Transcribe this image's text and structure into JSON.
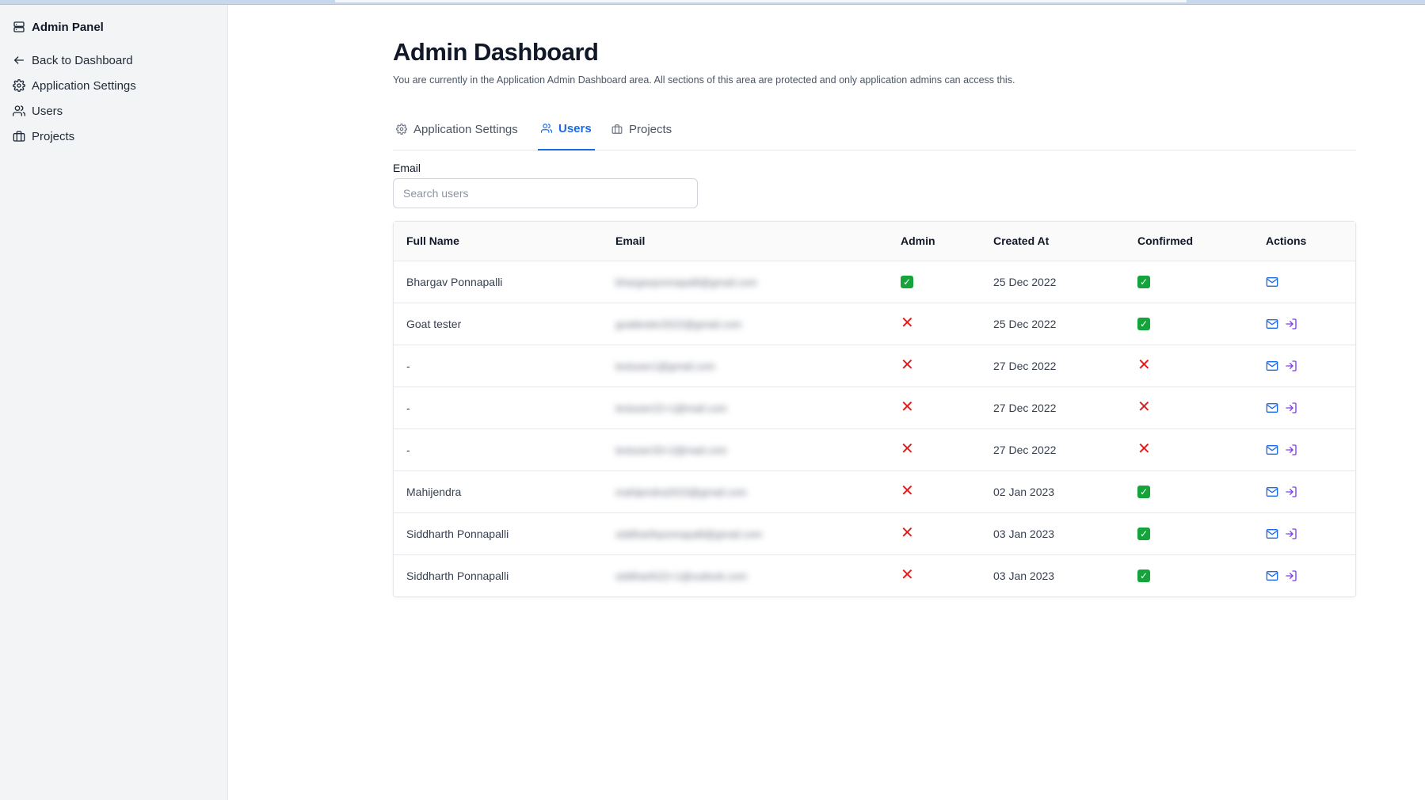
{
  "sidebar": {
    "title": "Admin Panel",
    "items": [
      {
        "label": "Back to Dashboard",
        "icon": "arrow-left-icon"
      },
      {
        "label": "Application Settings",
        "icon": "gear-icon"
      },
      {
        "label": "Users",
        "icon": "users-icon"
      },
      {
        "label": "Projects",
        "icon": "briefcase-icon"
      }
    ]
  },
  "main": {
    "title": "Admin Dashboard",
    "subtitle": "You are currently in the Application Admin Dashboard area. All sections of this area are protected and only application admins can access this.",
    "tabs": [
      {
        "label": "Application Settings",
        "active": false
      },
      {
        "label": "Users",
        "active": true
      },
      {
        "label": "Projects",
        "active": false
      }
    ],
    "search": {
      "label": "Email",
      "placeholder": "Search users",
      "value": ""
    },
    "table": {
      "columns": [
        "Full Name",
        "Email",
        "Admin",
        "Created At",
        "Confirmed",
        "Actions"
      ],
      "rows": [
        {
          "name": "Bhargav Ponnapalli",
          "email": "bhargavponnapalli@gmail.com",
          "admin": true,
          "created": "25 Dec 2022",
          "confirmed": true,
          "impersonate": false
        },
        {
          "name": "Goat tester",
          "email": "goattester2022@gmail.com",
          "admin": false,
          "created": "25 Dec 2022",
          "confirmed": true,
          "impersonate": true
        },
        {
          "name": "-",
          "email": "testuser1@gmail.com",
          "admin": false,
          "created": "27 Dec 2022",
          "confirmed": false,
          "impersonate": true
        },
        {
          "name": "-",
          "email": "testuser22+1@mail.com",
          "admin": false,
          "created": "27 Dec 2022",
          "confirmed": false,
          "impersonate": true
        },
        {
          "name": "-",
          "email": "testuser33+2@mail.com",
          "admin": false,
          "created": "27 Dec 2022",
          "confirmed": false,
          "impersonate": true
        },
        {
          "name": "Mahijendra",
          "email": "mahijendra2023@gmail.com",
          "admin": false,
          "created": "02 Jan 2023",
          "confirmed": true,
          "impersonate": true
        },
        {
          "name": "Siddharth Ponnapalli",
          "email": "siddharthponnapalli@gmail.com",
          "admin": false,
          "created": "03 Jan 2023",
          "confirmed": true,
          "impersonate": true
        },
        {
          "name": "Siddharth Ponnapalli",
          "email": "siddharth22+1@outlook.com",
          "admin": false,
          "created": "03 Jan 2023",
          "confirmed": true,
          "impersonate": true
        }
      ]
    }
  },
  "colors": {
    "accent": "#1d6ae5",
    "check": "#15a33b",
    "cross": "#e21b1b",
    "impersonate": "#7c3aed"
  }
}
